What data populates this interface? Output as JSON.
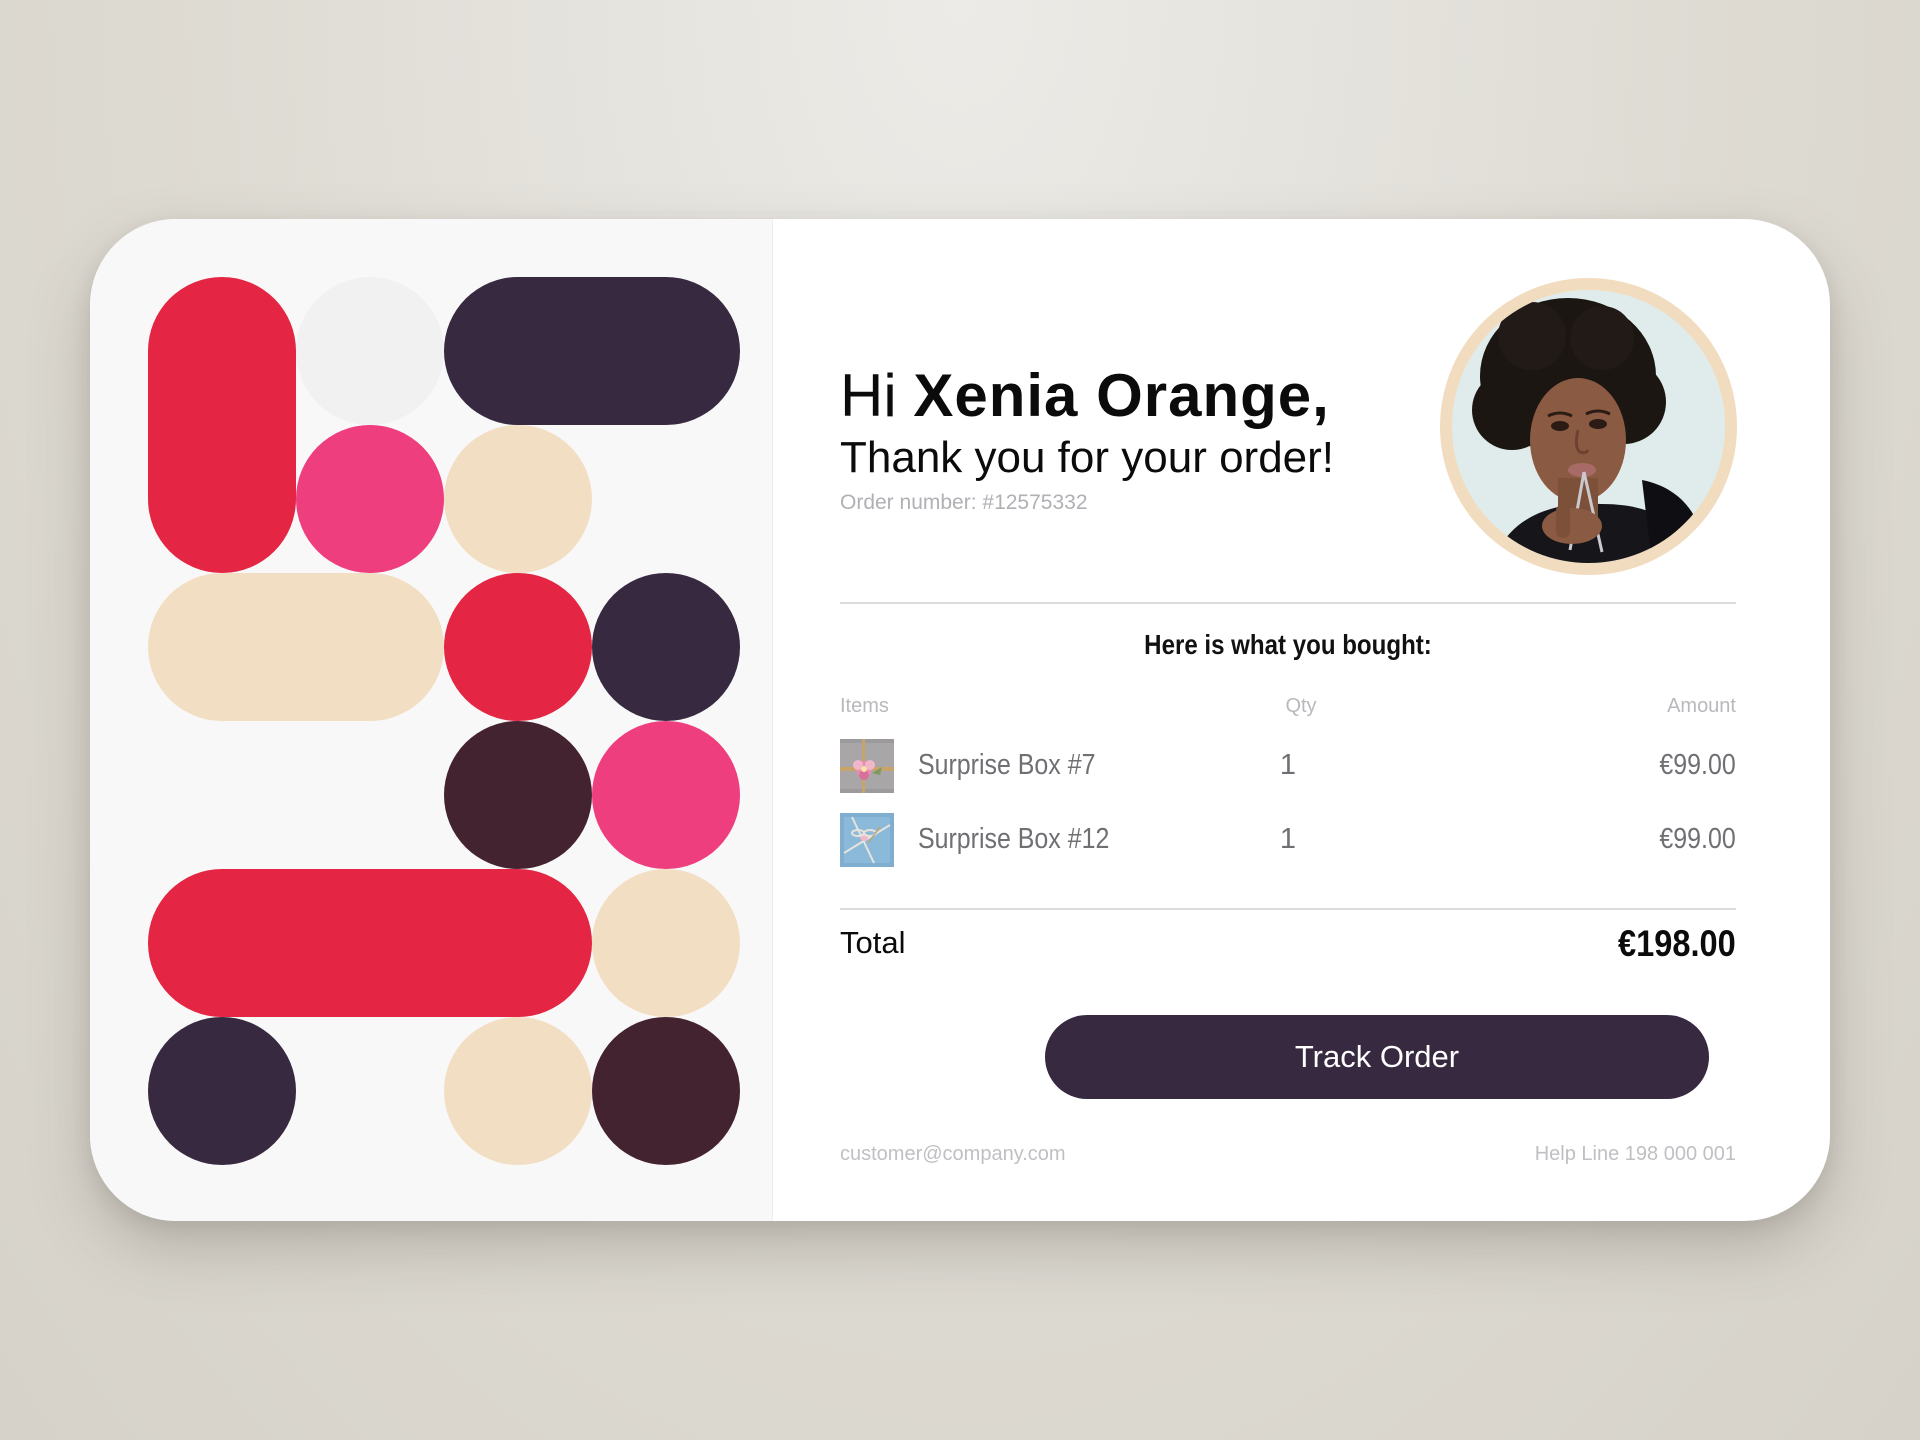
{
  "colors": {
    "page_background": "#dedbd3",
    "card_background": "#ffffff",
    "pattern_background": "#f8f8f8",
    "red": "#e42543",
    "pink": "#ee3e7e",
    "cream": "#f2dec3",
    "dark_purple": "#372940",
    "dark_maroon": "#442330",
    "light_gray": "#f1f1f1",
    "button": "#372940",
    "avatar_ring": "#f2dcc0"
  },
  "greeting": {
    "prefix": "Hi ",
    "name": "Xenia Orange,",
    "subtitle": "Thank you for your order!",
    "order_number": "Order number: #12575332"
  },
  "avatar": {
    "icon": "customer-photo-avatar"
  },
  "order": {
    "heading": "Here is what you bought:",
    "columns": {
      "items": "Items",
      "qty": "Qty",
      "amount": "Amount"
    },
    "items": [
      {
        "name": "Surprise Box #7",
        "qty": "1",
        "amount": "€99.00",
        "thumbnail": "gift-box-flower-thumbnail"
      },
      {
        "name": "Surprise Box #12",
        "qty": "1",
        "amount": "€99.00",
        "thumbnail": "gift-box-blue-thumbnail"
      }
    ],
    "total_label": "Total",
    "total_value": "€198.00"
  },
  "actions": {
    "track_order": "Track Order"
  },
  "footer": {
    "email": "customer@company.com",
    "help_line": "Help Line 198 000 001"
  }
}
